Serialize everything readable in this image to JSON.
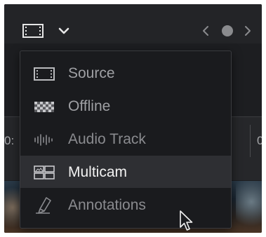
{
  "toolbar": {
    "clip_icon": "film-clip-icon",
    "dropdown_icon": "chevron-down-icon",
    "prev_icon": "chevron-left-icon",
    "dot_icon": "dot-icon",
    "next_icon": "chevron-right-icon"
  },
  "background": {
    "timecode_left": "0:",
    "timecode_right": "0"
  },
  "menu": {
    "items": [
      {
        "label": "Source",
        "icon": "film-clip-icon"
      },
      {
        "label": "Offline",
        "icon": "checker-icon"
      },
      {
        "label": "Audio Track",
        "icon": "waveform-icon"
      },
      {
        "label": "Multicam",
        "icon": "multicam-grid-icon",
        "highlighted": true
      },
      {
        "label": "Annotations",
        "icon": "pen-icon"
      }
    ]
  },
  "colors": {
    "panel_bg": "#1d1e21",
    "menu_bg": "#1a1b1e",
    "highlight_bg": "#2e2f33",
    "text": "#9fa0a4",
    "text_highlight": "#f2f2f2"
  }
}
